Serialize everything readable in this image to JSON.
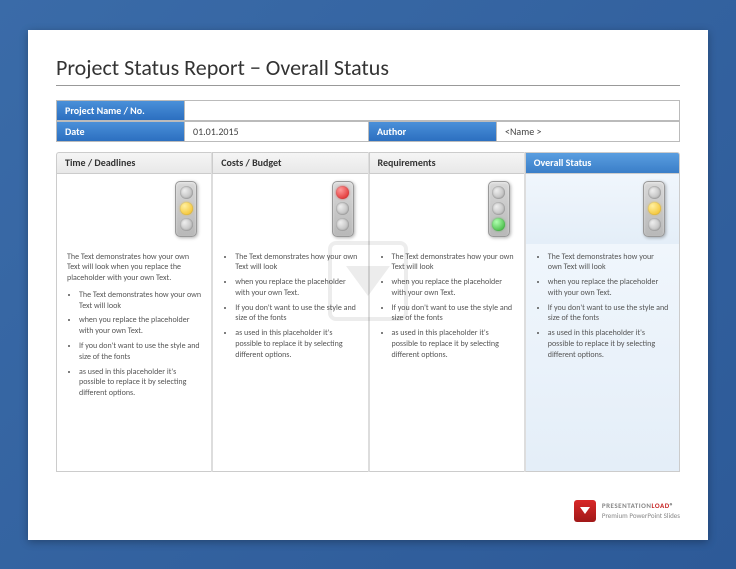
{
  "title": "Project Status Report − Overall Status",
  "info": {
    "project_label": "Project Name / No.",
    "project_value": "",
    "date_label": "Date",
    "date_value": "01.01.2015",
    "author_label": "Author",
    "author_value": "<Name >"
  },
  "columns": [
    {
      "header": "Time / Deadlines",
      "light": "yellow",
      "intro": "The Text demonstrates how your own Text will look when you replace the placeholder with your own Text.",
      "bullets": [
        "The Text demonstrates how your own Text will look",
        "when you replace the placeholder with your own Text.",
        "If you don't want to use the style and size of the fonts",
        "as used in this placeholder it's possible to replace it by selecting different options."
      ]
    },
    {
      "header": "Costs / Budget",
      "light": "red",
      "intro": "",
      "bullets": [
        "The Text demonstrates how your own Text will look",
        "when you replace the placeholder with your own Text.",
        "If you don't want to use the style and size of the fonts",
        "as used in this placeholder it's possible to replace it by selecting different options."
      ]
    },
    {
      "header": "Requirements",
      "light": "green",
      "intro": "",
      "bullets": [
        "The Text demonstrates how your own Text will look",
        "when you replace the placeholder with your own Text.",
        "If you don't want to use the style and size of the fonts",
        "as used in this placeholder it's possible to replace it by selecting different options."
      ]
    },
    {
      "header": "Overall Status",
      "light": "yellow",
      "intro": "",
      "bullets": [
        "The Text demonstrates how your own Text will look",
        "when you replace the placeholder with your own Text.",
        "If you don't want to use the style and size of the fonts",
        "as used in this placeholder it's possible to replace it by selecting different options."
      ]
    }
  ],
  "footer": {
    "brand1": "PRESENTATION",
    "brand2": "LOAD",
    "tagline": "Premium PowerPoint Slides"
  }
}
